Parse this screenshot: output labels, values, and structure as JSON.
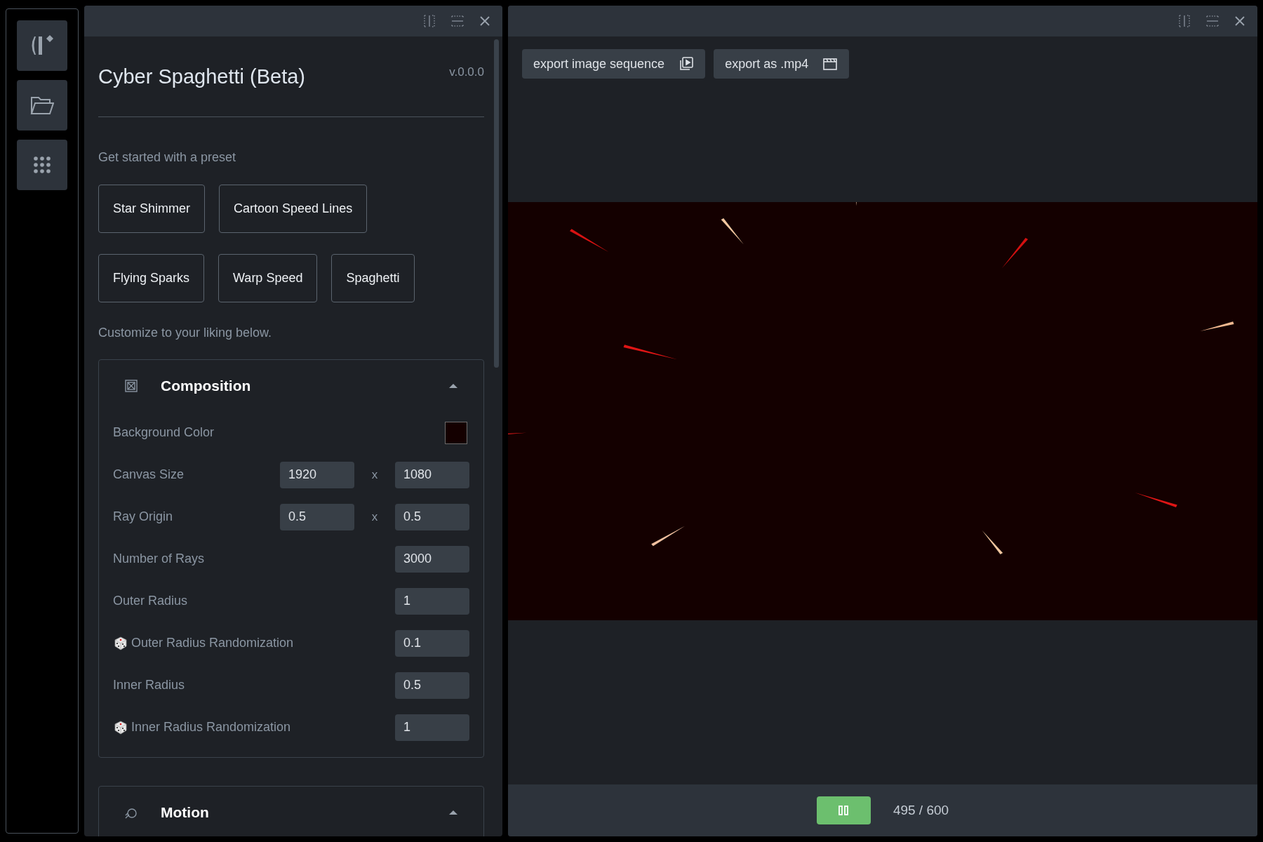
{
  "left_panel": {
    "title": "Cyber Spaghetti (Beta)",
    "version": "v.0.0.0",
    "preset_prompt": "Get started with a preset",
    "presets": [
      "Star Shimmer",
      "Cartoon Speed Lines",
      "Flying Sparks",
      "Warp Speed",
      "Spaghetti"
    ],
    "customize_hint": "Customize to your liking below.",
    "sections": [
      {
        "title": "Composition",
        "expanded": true,
        "fields": [
          {
            "kind": "color",
            "label": "Background Color",
            "color": "#140000"
          },
          {
            "kind": "pair",
            "label": "Canvas Size",
            "values": [
              "1920",
              "1080"
            ],
            "separator": "x"
          },
          {
            "kind": "pair",
            "label": "Ray Origin",
            "values": [
              "0.5",
              "0.5"
            ],
            "separator": "x"
          },
          {
            "kind": "single",
            "label": "Number of Rays",
            "value": "3000",
            "randomized": false
          },
          {
            "kind": "single",
            "label": "Outer Radius",
            "value": "1",
            "randomized": false
          },
          {
            "kind": "single",
            "label": "Outer Radius Randomization",
            "value": "0.1",
            "randomized": true
          },
          {
            "kind": "single",
            "label": "Inner Radius",
            "value": "0.5",
            "randomized": false
          },
          {
            "kind": "single",
            "label": "Inner Radius Randomization",
            "value": "1",
            "randomized": true
          }
        ]
      },
      {
        "title": "Motion",
        "expanded": true
      }
    ]
  },
  "right_panel": {
    "export_buttons": [
      {
        "label": "export image sequence",
        "kind": "sequence"
      },
      {
        "label": "export as .mp4",
        "kind": "video"
      }
    ],
    "playback": {
      "playing": true,
      "frame": "495 / 600"
    }
  }
}
